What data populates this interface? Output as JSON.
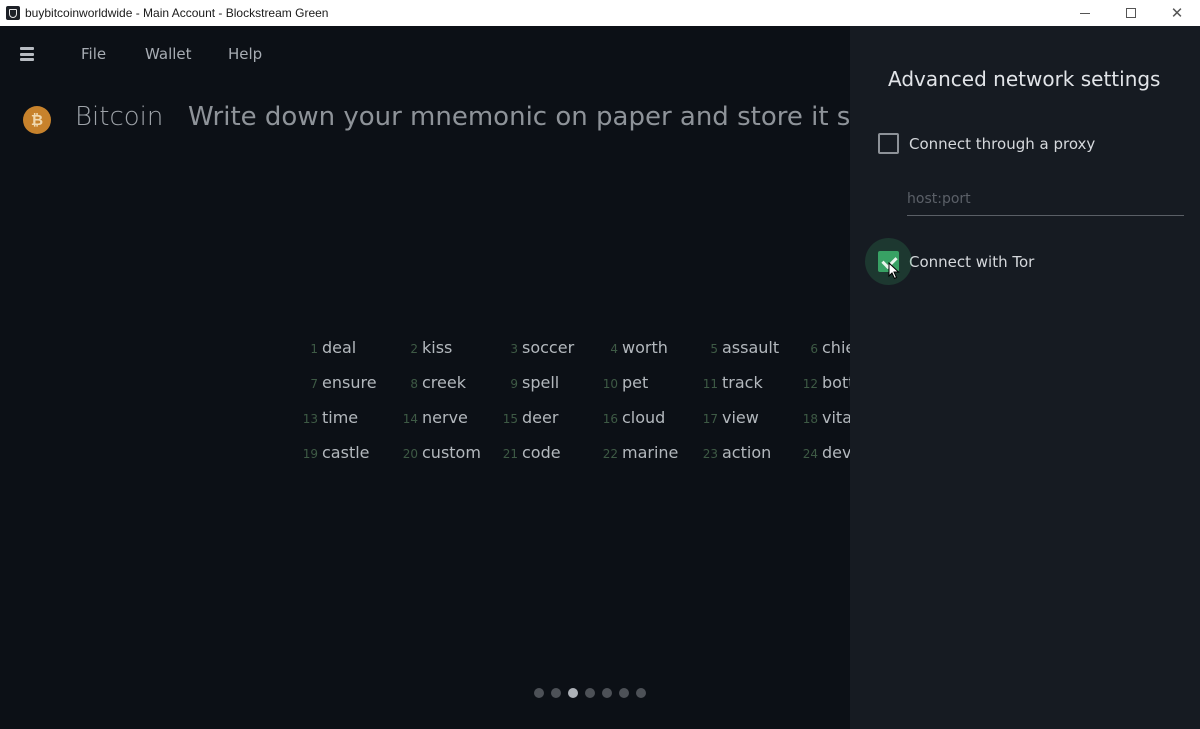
{
  "window": {
    "title": "buybitcoinworldwide - Main Account - Blockstream Green",
    "controls": {
      "minimize": "—",
      "maximize": "☐",
      "close": "✕"
    }
  },
  "menubar": {
    "items": [
      "File",
      "Wallet",
      "Help"
    ]
  },
  "header": {
    "network": "Bitcoin",
    "network_icon_glyph": "₿",
    "instruction": "Write down your mnemonic on paper and store it som"
  },
  "mnemonic": {
    "words": [
      {
        "n": "1",
        "w": "deal"
      },
      {
        "n": "2",
        "w": "kiss"
      },
      {
        "n": "3",
        "w": "soccer"
      },
      {
        "n": "4",
        "w": "worth"
      },
      {
        "n": "5",
        "w": "assault"
      },
      {
        "n": "6",
        "w": "chie"
      },
      {
        "n": "7",
        "w": "ensure"
      },
      {
        "n": "8",
        "w": "creek"
      },
      {
        "n": "9",
        "w": "spell"
      },
      {
        "n": "10",
        "w": "pet"
      },
      {
        "n": "11",
        "w": "track"
      },
      {
        "n": "12",
        "w": "bott"
      },
      {
        "n": "13",
        "w": "time"
      },
      {
        "n": "14",
        "w": "nerve"
      },
      {
        "n": "15",
        "w": "deer"
      },
      {
        "n": "16",
        "w": "cloud"
      },
      {
        "n": "17",
        "w": "view"
      },
      {
        "n": "18",
        "w": "vital"
      },
      {
        "n": "19",
        "w": "castle"
      },
      {
        "n": "20",
        "w": "custom"
      },
      {
        "n": "21",
        "w": "code"
      },
      {
        "n": "22",
        "w": "marine"
      },
      {
        "n": "23",
        "w": "action"
      },
      {
        "n": "24",
        "w": "deve"
      }
    ]
  },
  "pager": {
    "total": 7,
    "active_index": 2
  },
  "drawer": {
    "title": "Advanced network settings",
    "proxy": {
      "label": "Connect through a proxy",
      "checked": false,
      "placeholder": "host:port",
      "value": ""
    },
    "tor": {
      "label": "Connect with Tor",
      "checked": true
    }
  },
  "colors": {
    "accent": "#38a164",
    "bitcoin": "#c7822c",
    "background": "#0c1016",
    "drawer": "#161b22"
  }
}
